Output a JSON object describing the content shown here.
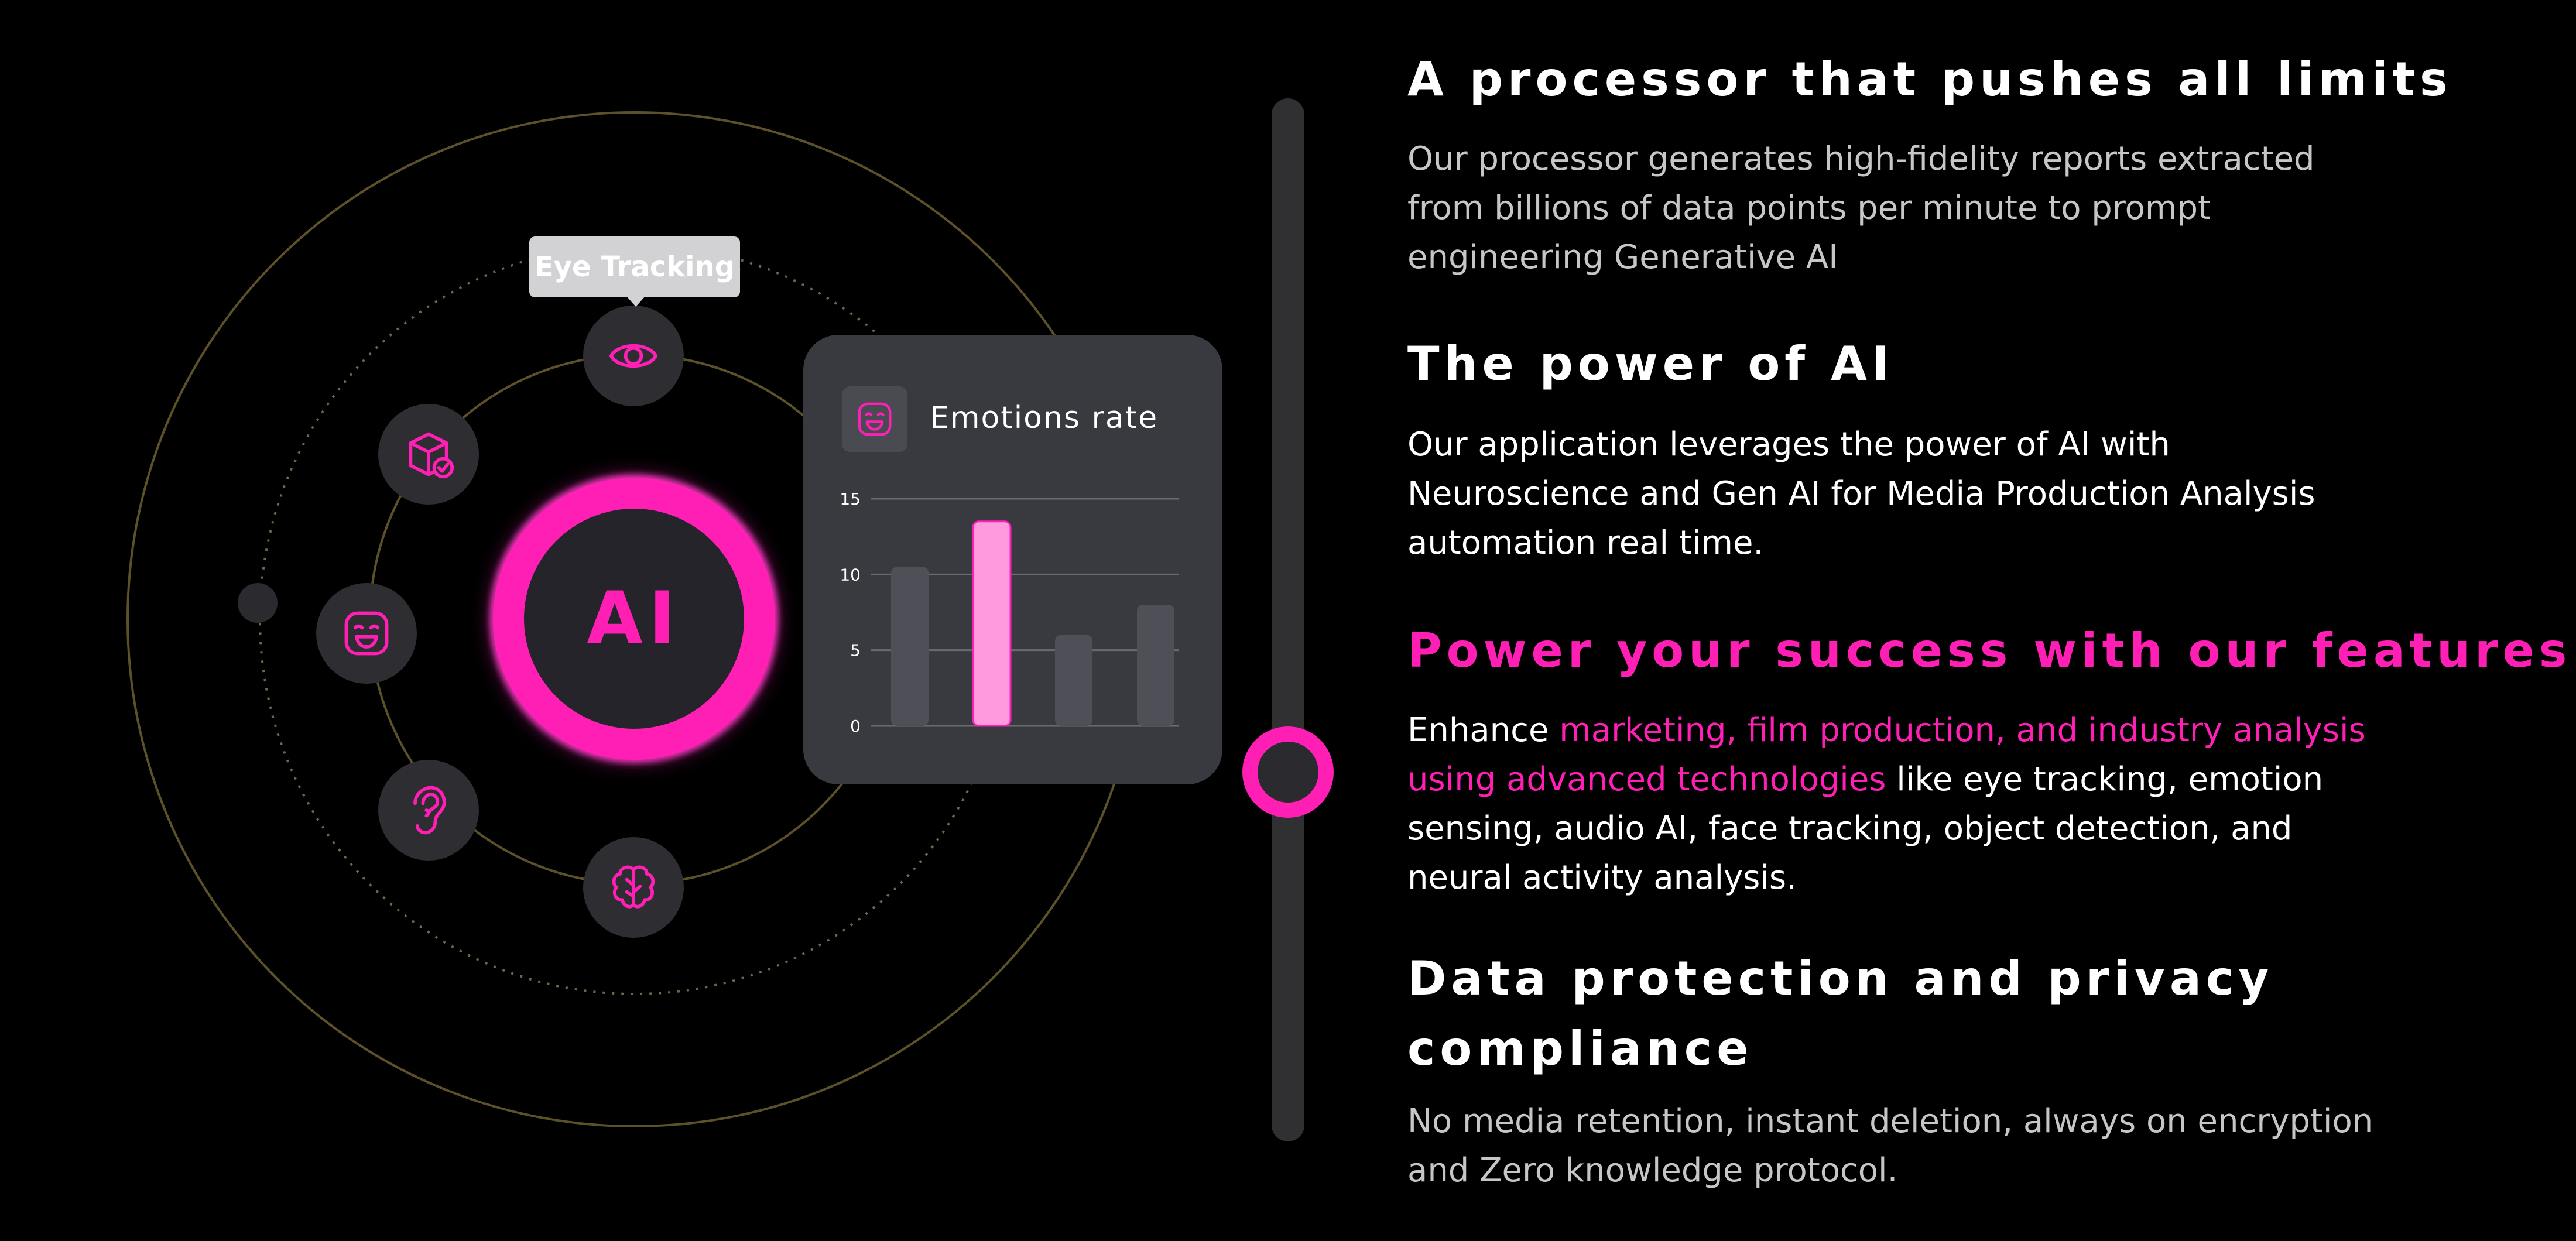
{
  "colors": {
    "accent": "#ff1fb4",
    "background": "#000000",
    "card": "#393a40",
    "node": "#2e2e32",
    "highlight_bar": "#ff9ade",
    "muted_bar": "#4f5057",
    "orbit_line": "#5c5128"
  },
  "diagram": {
    "core_label": "AI",
    "tooltip": "Eye Tracking",
    "nodes": [
      {
        "icon": "eye-icon"
      },
      {
        "icon": "cube-check-icon"
      },
      {
        "icon": "smiley-icon"
      },
      {
        "icon": "ear-icon"
      },
      {
        "icon": "brain-icon"
      }
    ]
  },
  "card": {
    "icon": "smiley-icon",
    "title": "Emotions rate"
  },
  "chart_data": {
    "type": "bar",
    "title": "Emotions rate",
    "categories": [
      "",
      "",
      "",
      ""
    ],
    "values": [
      10.5,
      13.5,
      6,
      8
    ],
    "highlighted_index": 1,
    "yticks": [
      "15",
      "10",
      "5",
      "0"
    ],
    "ylim": [
      0,
      15
    ],
    "grid": true
  },
  "slider": {
    "value": 0.66
  },
  "sections": {
    "s1": {
      "title": "A processor that pushes all limits",
      "lines": [
        "Our processor generates  high-fidelity reports extracted",
        "from billions of data points per minute to prompt",
        "engineering Generative AI"
      ]
    },
    "s2": {
      "title": "The power of AI",
      "lines": [
        "Our application leverages the power of AI with",
        "Neuroscience and Gen AI for Media Production Analysis",
        "automation real time."
      ]
    },
    "s3": {
      "title": "Power your success with our features",
      "l1_a": "Enhance ",
      "l1_b": "marketing, film production, and industry analysis",
      "l2_a": "using advanced technologies",
      "l2_b": " like eye tracking, emotion",
      "l3": "sensing, audio AI, face tracking, object detection, and",
      "l4": "neural activity analysis."
    },
    "s4": {
      "title_lines": [
        "Data protection and privacy",
        "compliance"
      ],
      "lines": [
        "No media retention, instant deletion, always on encryption",
        "and Zero knowledge protocol."
      ]
    }
  }
}
